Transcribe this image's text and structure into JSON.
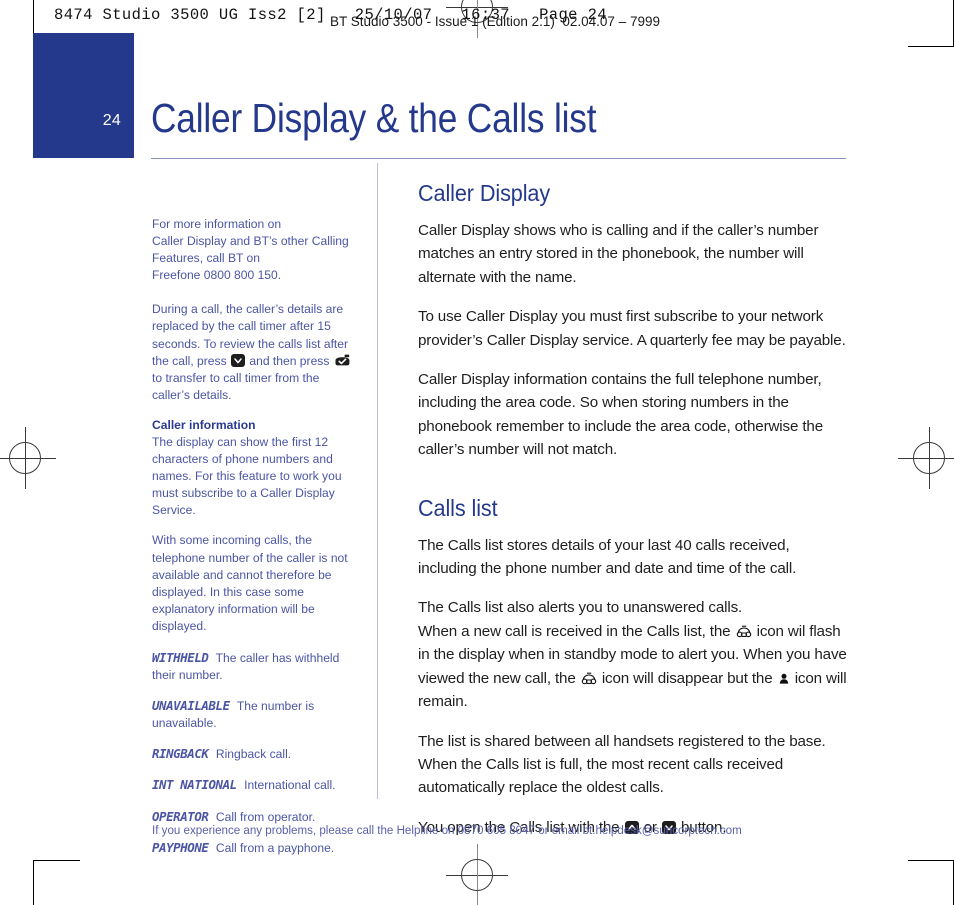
{
  "printer_slug": {
    "line1": "8474 Studio 3500 UG Iss2 [2]   25/10/07   16:37   Page 24",
    "line2": "BT Studio 3500 - Issue 1 (Edition 2.1)  02.04.07 – 7999"
  },
  "colors": {
    "brand_blue": "#24388c",
    "note_blue": "#4b55a4",
    "rule_blue": "#8a93c4",
    "divider_blue": "#b9c0dd",
    "body_text": "#1e1e1e",
    "footer_blue": "#5a61ab"
  },
  "page": {
    "number": "24",
    "chapter_title": "Caller Display & the Calls list"
  },
  "sidebar": {
    "intro": {
      "line1": "For more information on",
      "line2": "Caller Display and BT’s other Calling",
      "line3": "Features, call BT on",
      "line4": "Freefone 0800 800 150."
    },
    "during_call": {
      "part1": "During a call, the caller’s details are replaced by the call timer after 15 seconds. To review the calls list after the call, press",
      "part2": "and then press",
      "part3": "to transfer to call timer from the caller’s details."
    },
    "caller_information": {
      "heading": "Caller information",
      "paragraph1": "The display can show the first 12 characters of phone numbers and names. For this feature to work you must subscribe to a Caller Display Service.",
      "paragraph2": "With some incoming calls, the telephone number of the caller is not available and cannot therefore be displayed. In this case some explanatory information will be displayed."
    },
    "lcd_terms": [
      {
        "term": "WITHHELD",
        "description": "The caller has withheld their number."
      },
      {
        "term": "UNAVAILABLE",
        "description": "The number is unavailable."
      },
      {
        "term": "RINGBACK",
        "description": "Ringback call."
      },
      {
        "term": "INT NATIONAL",
        "description": "International call."
      },
      {
        "term": "OPERATOR",
        "description": "Call from operator."
      },
      {
        "term": "PAYPHONE",
        "description": "Call from a payphone."
      }
    ]
  },
  "main": {
    "caller_display": {
      "heading": "Caller Display",
      "paragraph1": "Caller Display shows who is calling and if the caller’s number matches an entry stored in the phonebook, the number will alternate with the name.",
      "paragraph2": "To use Caller Display you must first subscribe to your network provider’s Caller Display service. A quarterly fee may be payable.",
      "paragraph3": "Caller Display information contains the full telephone number, including the area code. So when storing numbers in the phonebook remember to include the area code, otherwise the caller’s number will not match."
    },
    "calls_list": {
      "heading": "Calls list",
      "paragraph1": "The Calls list stores details of your last 40 calls received, including the phone number and date and time of the call.",
      "paragraph2_a": "The Calls list also alerts you to unanswered calls.",
      "paragraph2_b": "When a new call is received in the Calls list, the",
      "paragraph2_c": "icon wil flash in the display when in standby mode to alert you. When you have viewed the new call, the",
      "paragraph2_d": "icon will disappear but the",
      "paragraph2_e": "icon will remain.",
      "paragraph3": "The list is shared between all handsets registered to the base. When the Calls list is full, the most recent calls received automatically replace the oldest calls.",
      "paragraph4_a": "You open the Calls list with the",
      "paragraph4_b": "or",
      "paragraph4_c": "button."
    }
  },
  "footer": {
    "text": "If you experience any problems, please call the Helpline on 0870 605 8047 or email bt.helpdesk@suncorptech.com"
  }
}
